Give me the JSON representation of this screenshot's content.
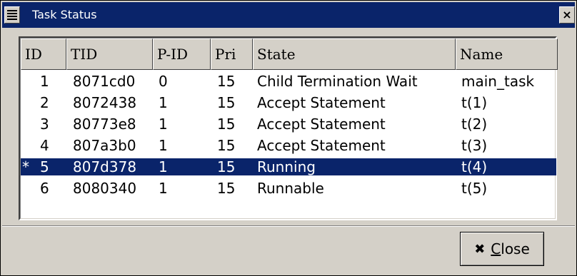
{
  "window": {
    "title": "Task Status",
    "close_glyph": "×"
  },
  "table": {
    "columns": [
      "ID",
      "TID",
      "P-ID",
      "Pri",
      "State",
      "Name"
    ],
    "rows": [
      {
        "mark": "",
        "id": "1",
        "tid": "8071cd0",
        "pid": "0",
        "pri": "15",
        "state": "Child Termination Wait",
        "name": "main_task",
        "selected": false
      },
      {
        "mark": "",
        "id": "2",
        "tid": "8072438",
        "pid": "1",
        "pri": "15",
        "state": "Accept Statement",
        "name": "t(1)",
        "selected": false
      },
      {
        "mark": "",
        "id": "3",
        "tid": "80773e8",
        "pid": "1",
        "pri": "15",
        "state": "Accept Statement",
        "name": "t(2)",
        "selected": false
      },
      {
        "mark": "",
        "id": "4",
        "tid": "807a3b0",
        "pid": "1",
        "pri": "15",
        "state": "Accept Statement",
        "name": "t(3)",
        "selected": false
      },
      {
        "mark": "*",
        "id": "5",
        "tid": "807d378",
        "pid": "1",
        "pri": "15",
        "state": "Running",
        "name": "t(4)",
        "selected": true
      },
      {
        "mark": "",
        "id": "6",
        "tid": "8080340",
        "pid": "1",
        "pri": "15",
        "state": "Runnable",
        "name": "t(5)",
        "selected": false
      }
    ]
  },
  "close_button": {
    "icon": "close-x-icon",
    "glyph": "✖",
    "mnemonic": "C",
    "label_rest": "lose"
  },
  "colors": {
    "titlebar": "#0a246a",
    "selection": "#0a246a",
    "face": "#d4d0c8"
  }
}
